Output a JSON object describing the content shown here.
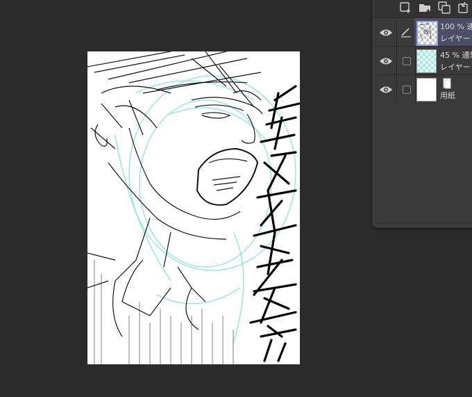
{
  "layers_panel": {
    "toolbar_icons": [
      "new-raster-layer-icon",
      "new-folder-icon",
      "duplicate-layer-icon",
      "merge-down-icon"
    ],
    "layers": [
      {
        "opacity": "100 %",
        "blend": "通常",
        "name": "レイヤー",
        "thumbnail": "sketch",
        "editing": true,
        "selected": true
      },
      {
        "opacity": "45 %",
        "blend": "通常",
        "name": "レイヤー",
        "thumbnail": "cyan-checker",
        "editing": false,
        "selected": false
      },
      {
        "opacity": "",
        "blend": "",
        "name": "用紙",
        "thumbnail": "paper",
        "editing": false,
        "selected": false
      }
    ]
  },
  "canvas": {
    "artwork": "rough manga sketch of a shouting man with vertical text strokes",
    "sketch_colors": {
      "ink": "#111111",
      "guide": "#7fe3d3"
    }
  }
}
